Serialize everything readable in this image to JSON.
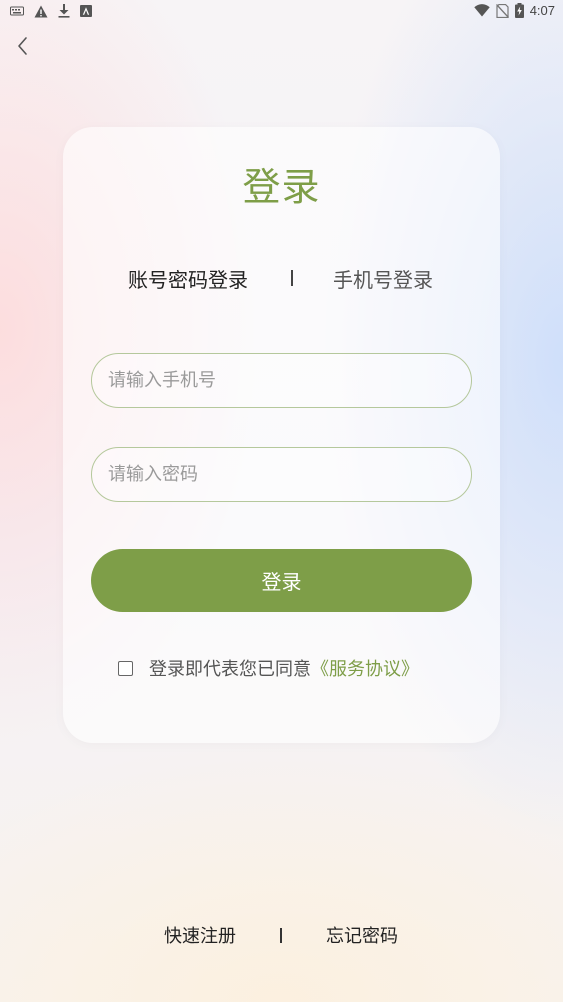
{
  "status_bar": {
    "time": "4:07",
    "left_icons": [
      "keyboard-icon",
      "warning-icon",
      "download-icon",
      "font-icon"
    ],
    "right_icons": [
      "wifi-icon",
      "no-sim-icon",
      "battery-charging-icon"
    ]
  },
  "nav": {
    "back_icon": "chevron-left-icon"
  },
  "login": {
    "title": "登录",
    "tabs": [
      {
        "label": "账号密码登录",
        "active": true
      },
      {
        "label": "手机号登录",
        "active": false
      }
    ],
    "phone_placeholder": "请输入手机号",
    "password_placeholder": "请输入密码",
    "submit_label": "登录",
    "agreement_text": "登录即代表您已同意",
    "agreement_link": "《服务协议》"
  },
  "footer": {
    "register_label": "快速注册",
    "forgot_label": "忘记密码"
  },
  "colors": {
    "accent": "#7e9e48",
    "input_border": "#b5c89c"
  }
}
